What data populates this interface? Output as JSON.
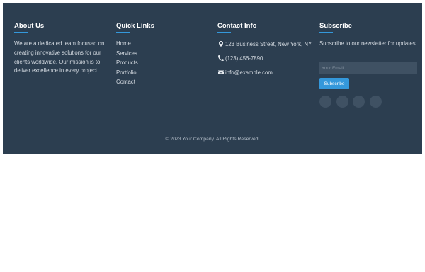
{
  "about": {
    "heading": "About Us",
    "text": "We are a dedicated team focused on creating innovative solutions for our clients worldwide. Our mission is to deliver excellence in every project."
  },
  "quick_links": {
    "heading": "Quick Links",
    "items": [
      "Home",
      "Services",
      "Products",
      "Portfolio",
      "Contact"
    ]
  },
  "contact": {
    "heading": "Contact Info",
    "address": "123 Business Street, New York, NY",
    "phone": "(123) 456-7890",
    "email": "info@example.com",
    "icons": [
      "map-marker-icon",
      "phone-icon",
      "envelope-icon"
    ]
  },
  "subscribe": {
    "heading": "Subscribe",
    "text": "Subscribe to our newsletter for updates.",
    "input_placeholder": "Your Email",
    "button_label": "Subscribe",
    "social_icons": [
      "social-icon-1",
      "social-icon-2",
      "social-icon-3",
      "social-icon-4"
    ]
  },
  "footer": {
    "copyright": "© 2023 Your Company. All Rights Reserved."
  },
  "colors": {
    "background": "#2c3e50",
    "accent": "#3498db",
    "input_background": "#3f5163"
  }
}
